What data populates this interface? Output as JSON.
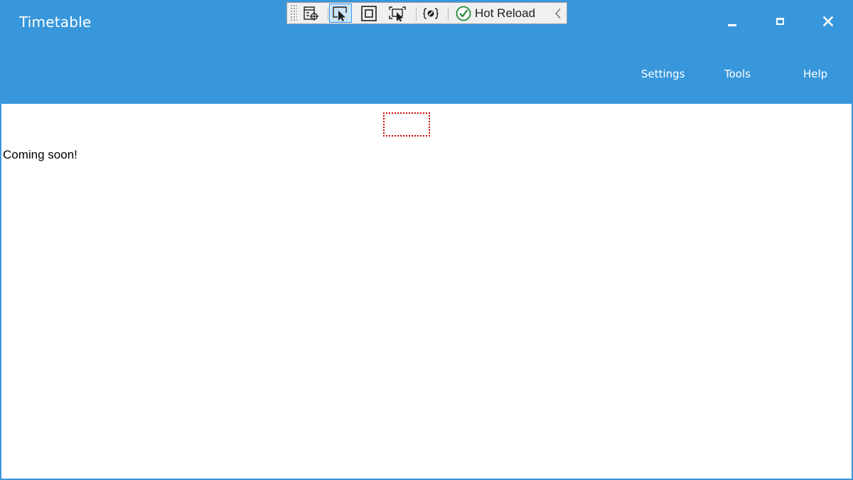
{
  "window": {
    "title": "Timetable",
    "accent_color": "#3897db"
  },
  "caption_buttons": {
    "minimize_icon": "minimize-icon",
    "maximize_icon": "maximize-icon",
    "close_icon": "close-icon"
  },
  "menu": {
    "items": [
      {
        "label": "Settings"
      },
      {
        "label": "Tools"
      },
      {
        "label": "Help"
      }
    ]
  },
  "xaml_toolbar": {
    "buttons": [
      {
        "icon": "go-to-live-visual-tree-icon",
        "active": false
      },
      {
        "icon": "select-element-icon",
        "active": true
      },
      {
        "icon": "display-layout-adorners-icon",
        "active": false
      },
      {
        "icon": "track-focused-element-icon",
        "active": false
      },
      {
        "icon": "binding-failures-icon",
        "active": false
      }
    ],
    "hot_reload_label": "Hot Reload",
    "hot_reload_status_icon": "check-circle-icon",
    "collapse_icon": "chevron-left-icon"
  },
  "content": {
    "message": "Coming soon!"
  }
}
